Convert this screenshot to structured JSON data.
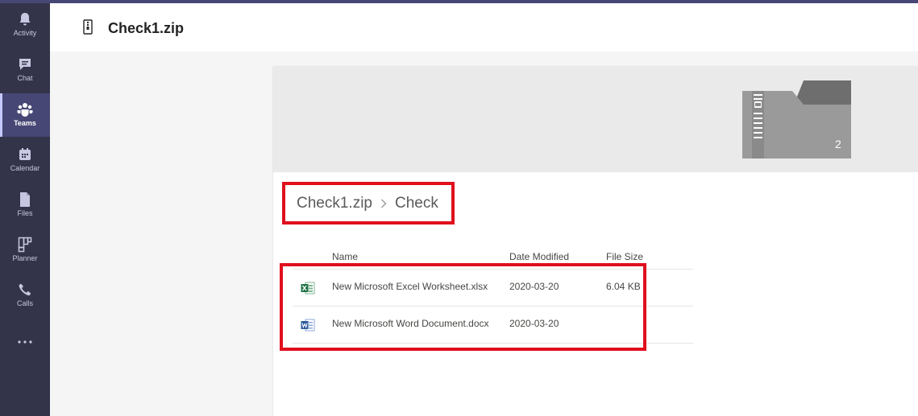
{
  "app": {
    "rail": [
      {
        "key": "activity",
        "label": "Activity",
        "icon": "bell-icon"
      },
      {
        "key": "chat",
        "label": "Chat",
        "icon": "chat-icon"
      },
      {
        "key": "teams",
        "label": "Teams",
        "icon": "teams-icon",
        "active": true
      },
      {
        "key": "calendar",
        "label": "Calendar",
        "icon": "calendar-icon"
      },
      {
        "key": "files",
        "label": "Files",
        "icon": "files-icon"
      },
      {
        "key": "planner",
        "label": "Planner",
        "icon": "planner-icon"
      },
      {
        "key": "calls",
        "label": "Calls",
        "icon": "phone-icon"
      }
    ],
    "more_icon": "ellipsis-icon"
  },
  "header": {
    "title": "Check1.zip",
    "icon": "zip-file-icon"
  },
  "viewer": {
    "folder_item_count": "2",
    "breadcrumb": [
      "Check1.zip",
      "Check"
    ],
    "columns": {
      "name": "Name",
      "date": "Date Modified",
      "size": "File Size"
    },
    "files": [
      {
        "name": "New Microsoft Excel Worksheet.xlsx",
        "date": "2020-03-20",
        "size": "6.04 KB",
        "icon": "excel-icon"
      },
      {
        "name": "New Microsoft Word Document.docx",
        "date": "2020-03-20",
        "size": "",
        "icon": "word-icon"
      }
    ]
  },
  "colors": {
    "rail_bg": "#33344a",
    "accent": "#464775",
    "highlight_box": "#e0101d"
  }
}
